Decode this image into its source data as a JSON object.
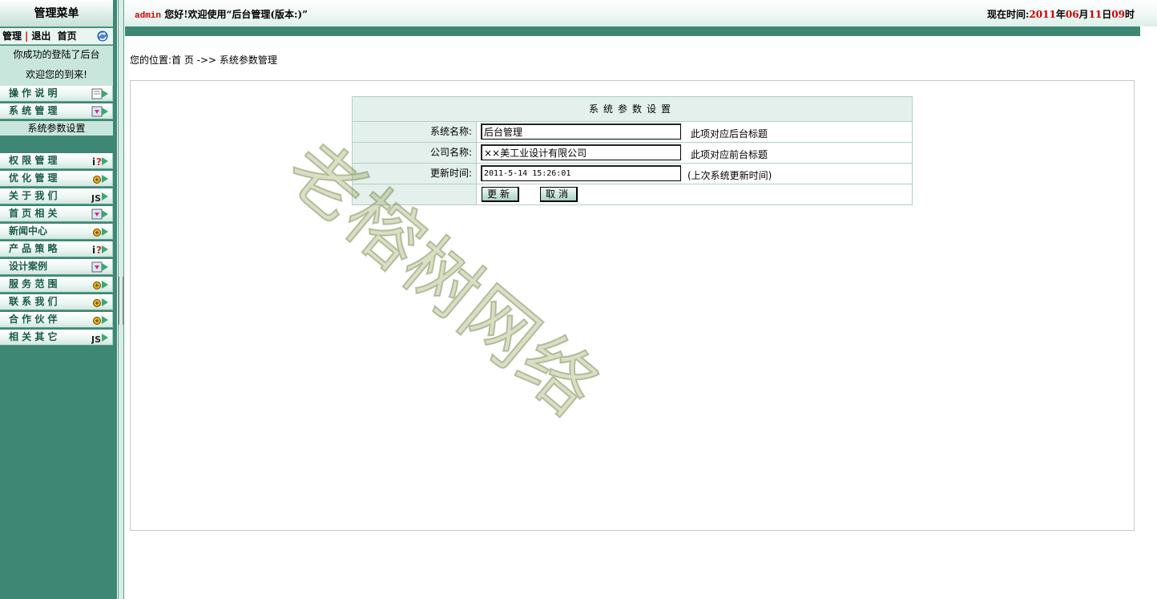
{
  "sidebar": {
    "title": "管理菜单",
    "links": {
      "manage": "管理",
      "separator": "|",
      "logout": "退出",
      "home": "首页"
    },
    "welcome": {
      "line1": "你成功的登陆了后台",
      "line2": "欢迎您的到来!"
    },
    "menu": [
      {
        "label": "操 作 说 明",
        "icon": "notepad-icon"
      },
      {
        "label": "系 统 管 理",
        "icon": "download-icon"
      }
    ],
    "submenu": [
      {
        "label": "系统参数设置"
      }
    ],
    "menu2": [
      {
        "label": "权 限 管 理",
        "icon": "info-icon"
      },
      {
        "label": "优 化 管 理",
        "icon": "gear-icon"
      },
      {
        "label": "关 于 我 们",
        "icon": "js-icon"
      },
      {
        "label": "首 页 相 关",
        "icon": "download-icon"
      },
      {
        "label": "新闻中心",
        "icon": "gear-icon"
      },
      {
        "label": "产 品 策 略",
        "icon": "info-icon"
      },
      {
        "label": "设计案例",
        "icon": "download-icon"
      },
      {
        "label": "服 务 范 围",
        "icon": "gear-icon"
      },
      {
        "label": "联 系 我 们",
        "icon": "gear-icon"
      },
      {
        "label": "合 作 伙 伴",
        "icon": "gear-icon"
      },
      {
        "label": "相 关 其 它",
        "icon": "js-icon"
      }
    ]
  },
  "header": {
    "user": "admin",
    "greeting": "您好!欢迎使用“后台管理(版本:)”",
    "time_prefix": "现在时间:",
    "year": "2011",
    "year_unit": "年",
    "month": "06",
    "month_unit": "月",
    "day": "11",
    "day_unit": "日",
    "hour": "09",
    "hour_unit": "时"
  },
  "breadcrumb": "您的位置:首 页 ->> 系统参数管理",
  "settings": {
    "title": "系统参数设置",
    "fields": [
      {
        "label": "系统名称:",
        "value": "后台管理",
        "hint": "此项对应后台标题"
      },
      {
        "label": "公司名称:",
        "value": "××美工业设计有限公司",
        "hint": "此项对应前台标题"
      },
      {
        "label": "更新时间:",
        "value": "2011-5-14 15:26:01",
        "hint": "(上次系统更新时间)"
      }
    ],
    "update_button": "更新",
    "cancel_button": "取消"
  },
  "watermark": "老榕树网络",
  "colors": {
    "sidebar_bg": "#3e8775",
    "accent_red": "#cc0000",
    "panel_bg": "#e3f0ec"
  }
}
